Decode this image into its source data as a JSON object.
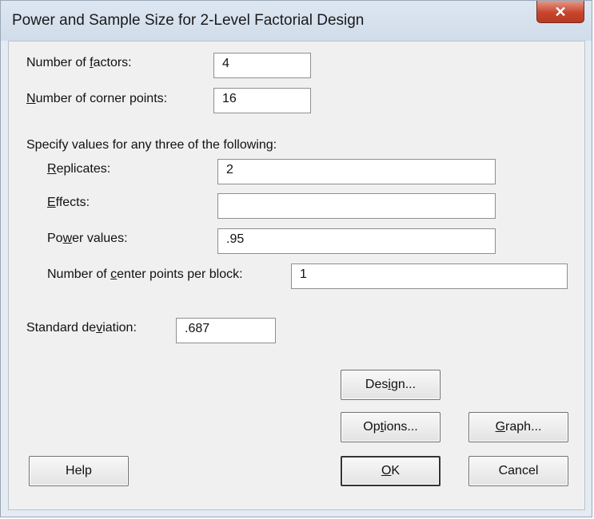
{
  "window": {
    "title": "Power and Sample Size for 2-Level Factorial Design",
    "close_glyph": "✕"
  },
  "form": {
    "factors": {
      "pre": "Number of ",
      "key": "f",
      "post": "actors:",
      "value": "4"
    },
    "corner_points": {
      "pre": "",
      "key": "N",
      "post": "umber of corner points:",
      "value": "16"
    },
    "instruction": "Specify values for any three of the following:",
    "replicates": {
      "pre": "",
      "key": "R",
      "post": "eplicates:",
      "value": "2"
    },
    "effects": {
      "pre": "",
      "key": "E",
      "post": "ffects:",
      "value": ""
    },
    "power": {
      "pre": "Po",
      "key": "w",
      "post": "er values:",
      "value": ".95"
    },
    "center_points": {
      "pre": "Number of ",
      "key": "c",
      "post": "enter points per block:",
      "value": "1"
    },
    "std_dev": {
      "pre": "Standard de",
      "key": "v",
      "post": "iation:",
      "value": ".687"
    }
  },
  "buttons": {
    "design": {
      "pre": "Des",
      "key": "i",
      "post": "gn..."
    },
    "options": {
      "pre": "Op",
      "key": "t",
      "post": "ions..."
    },
    "graph": {
      "pre": "",
      "key": "G",
      "post": "raph..."
    },
    "help": {
      "pre": "Help",
      "key": "",
      "post": ""
    },
    "ok": {
      "pre": "",
      "key": "O",
      "post": "K"
    },
    "cancel": {
      "pre": "Cancel",
      "key": "",
      "post": ""
    }
  }
}
